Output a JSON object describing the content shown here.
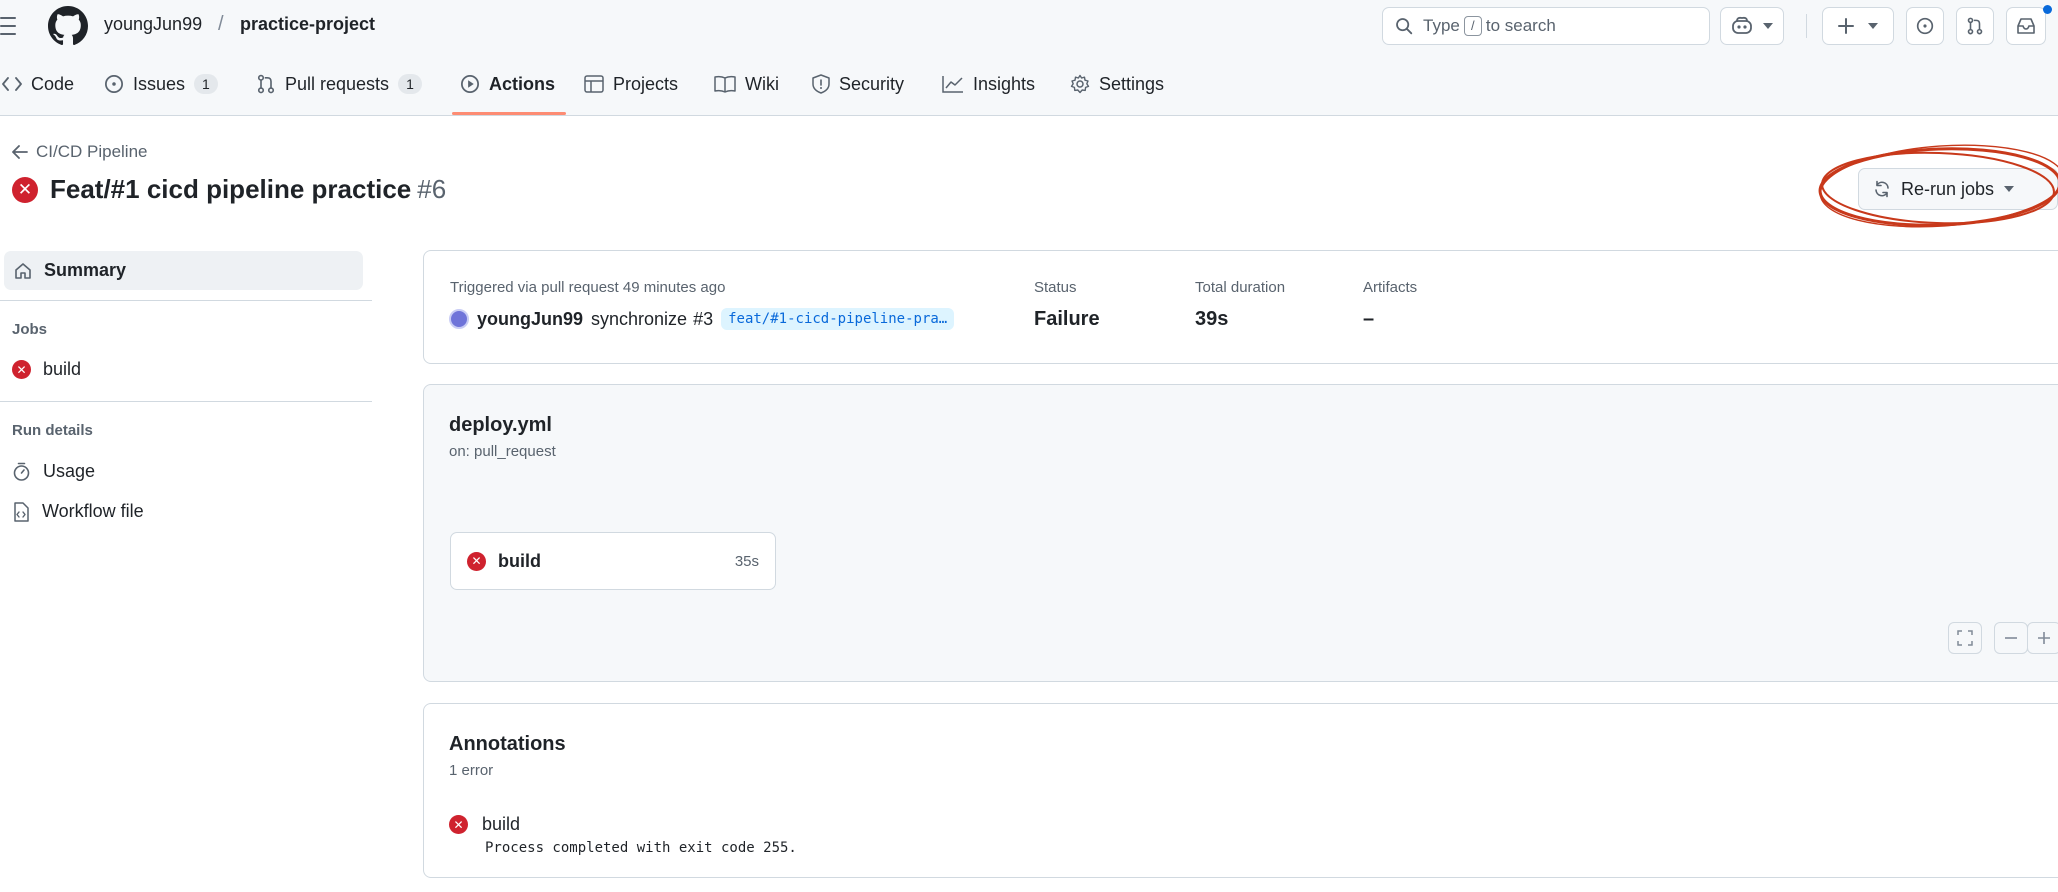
{
  "header": {
    "owner": "youngJun99",
    "separator": "/",
    "repo": "practice-project",
    "search": {
      "prefix": "Type",
      "key": "/",
      "suffix": "to search"
    }
  },
  "tabs": [
    {
      "label": "Code",
      "icon": "code-icon"
    },
    {
      "label": "Issues",
      "icon": "issue-icon",
      "count": "1"
    },
    {
      "label": "Pull requests",
      "icon": "pull-request-icon",
      "count": "1"
    },
    {
      "label": "Actions",
      "icon": "play-icon",
      "active": true
    },
    {
      "label": "Projects",
      "icon": "table-icon"
    },
    {
      "label": "Wiki",
      "icon": "book-icon"
    },
    {
      "label": "Security",
      "icon": "shield-icon"
    },
    {
      "label": "Insights",
      "icon": "graph-icon"
    },
    {
      "label": "Settings",
      "icon": "gear-icon"
    }
  ],
  "run": {
    "back_label": "CI/CD Pipeline",
    "title": "Feat/#1 cicd pipeline practice",
    "number": "#6",
    "rerun_label": "Re-run jobs"
  },
  "sidebar": {
    "summary": "Summary",
    "jobs_heading": "Jobs",
    "job": "build",
    "run_details_heading": "Run details",
    "usage": "Usage",
    "workflow_file": "Workflow file"
  },
  "summary_card": {
    "trigger_label": "Triggered via pull request 49 minutes ago",
    "actor": "youngJun99",
    "action": "synchronize",
    "pr": "#3",
    "branch": "feat/#1-cicd-pipeline-pra…",
    "status_label": "Status",
    "status_value": "Failure",
    "duration_label": "Total duration",
    "duration_value": "39s",
    "artifacts_label": "Artifacts",
    "artifacts_value": "–"
  },
  "workflow": {
    "file": "deploy.yml",
    "on": "on: pull_request",
    "job_name": "build",
    "job_duration": "35s"
  },
  "annotations": {
    "title": "Annotations",
    "count": "1 error",
    "job": "build",
    "message": "Process completed with exit code 255."
  },
  "colors": {
    "failure": "#cf222e",
    "accent_underline": "#fd8c73",
    "highlight_circle": "#c8391b",
    "branch_text": "#0969da"
  }
}
